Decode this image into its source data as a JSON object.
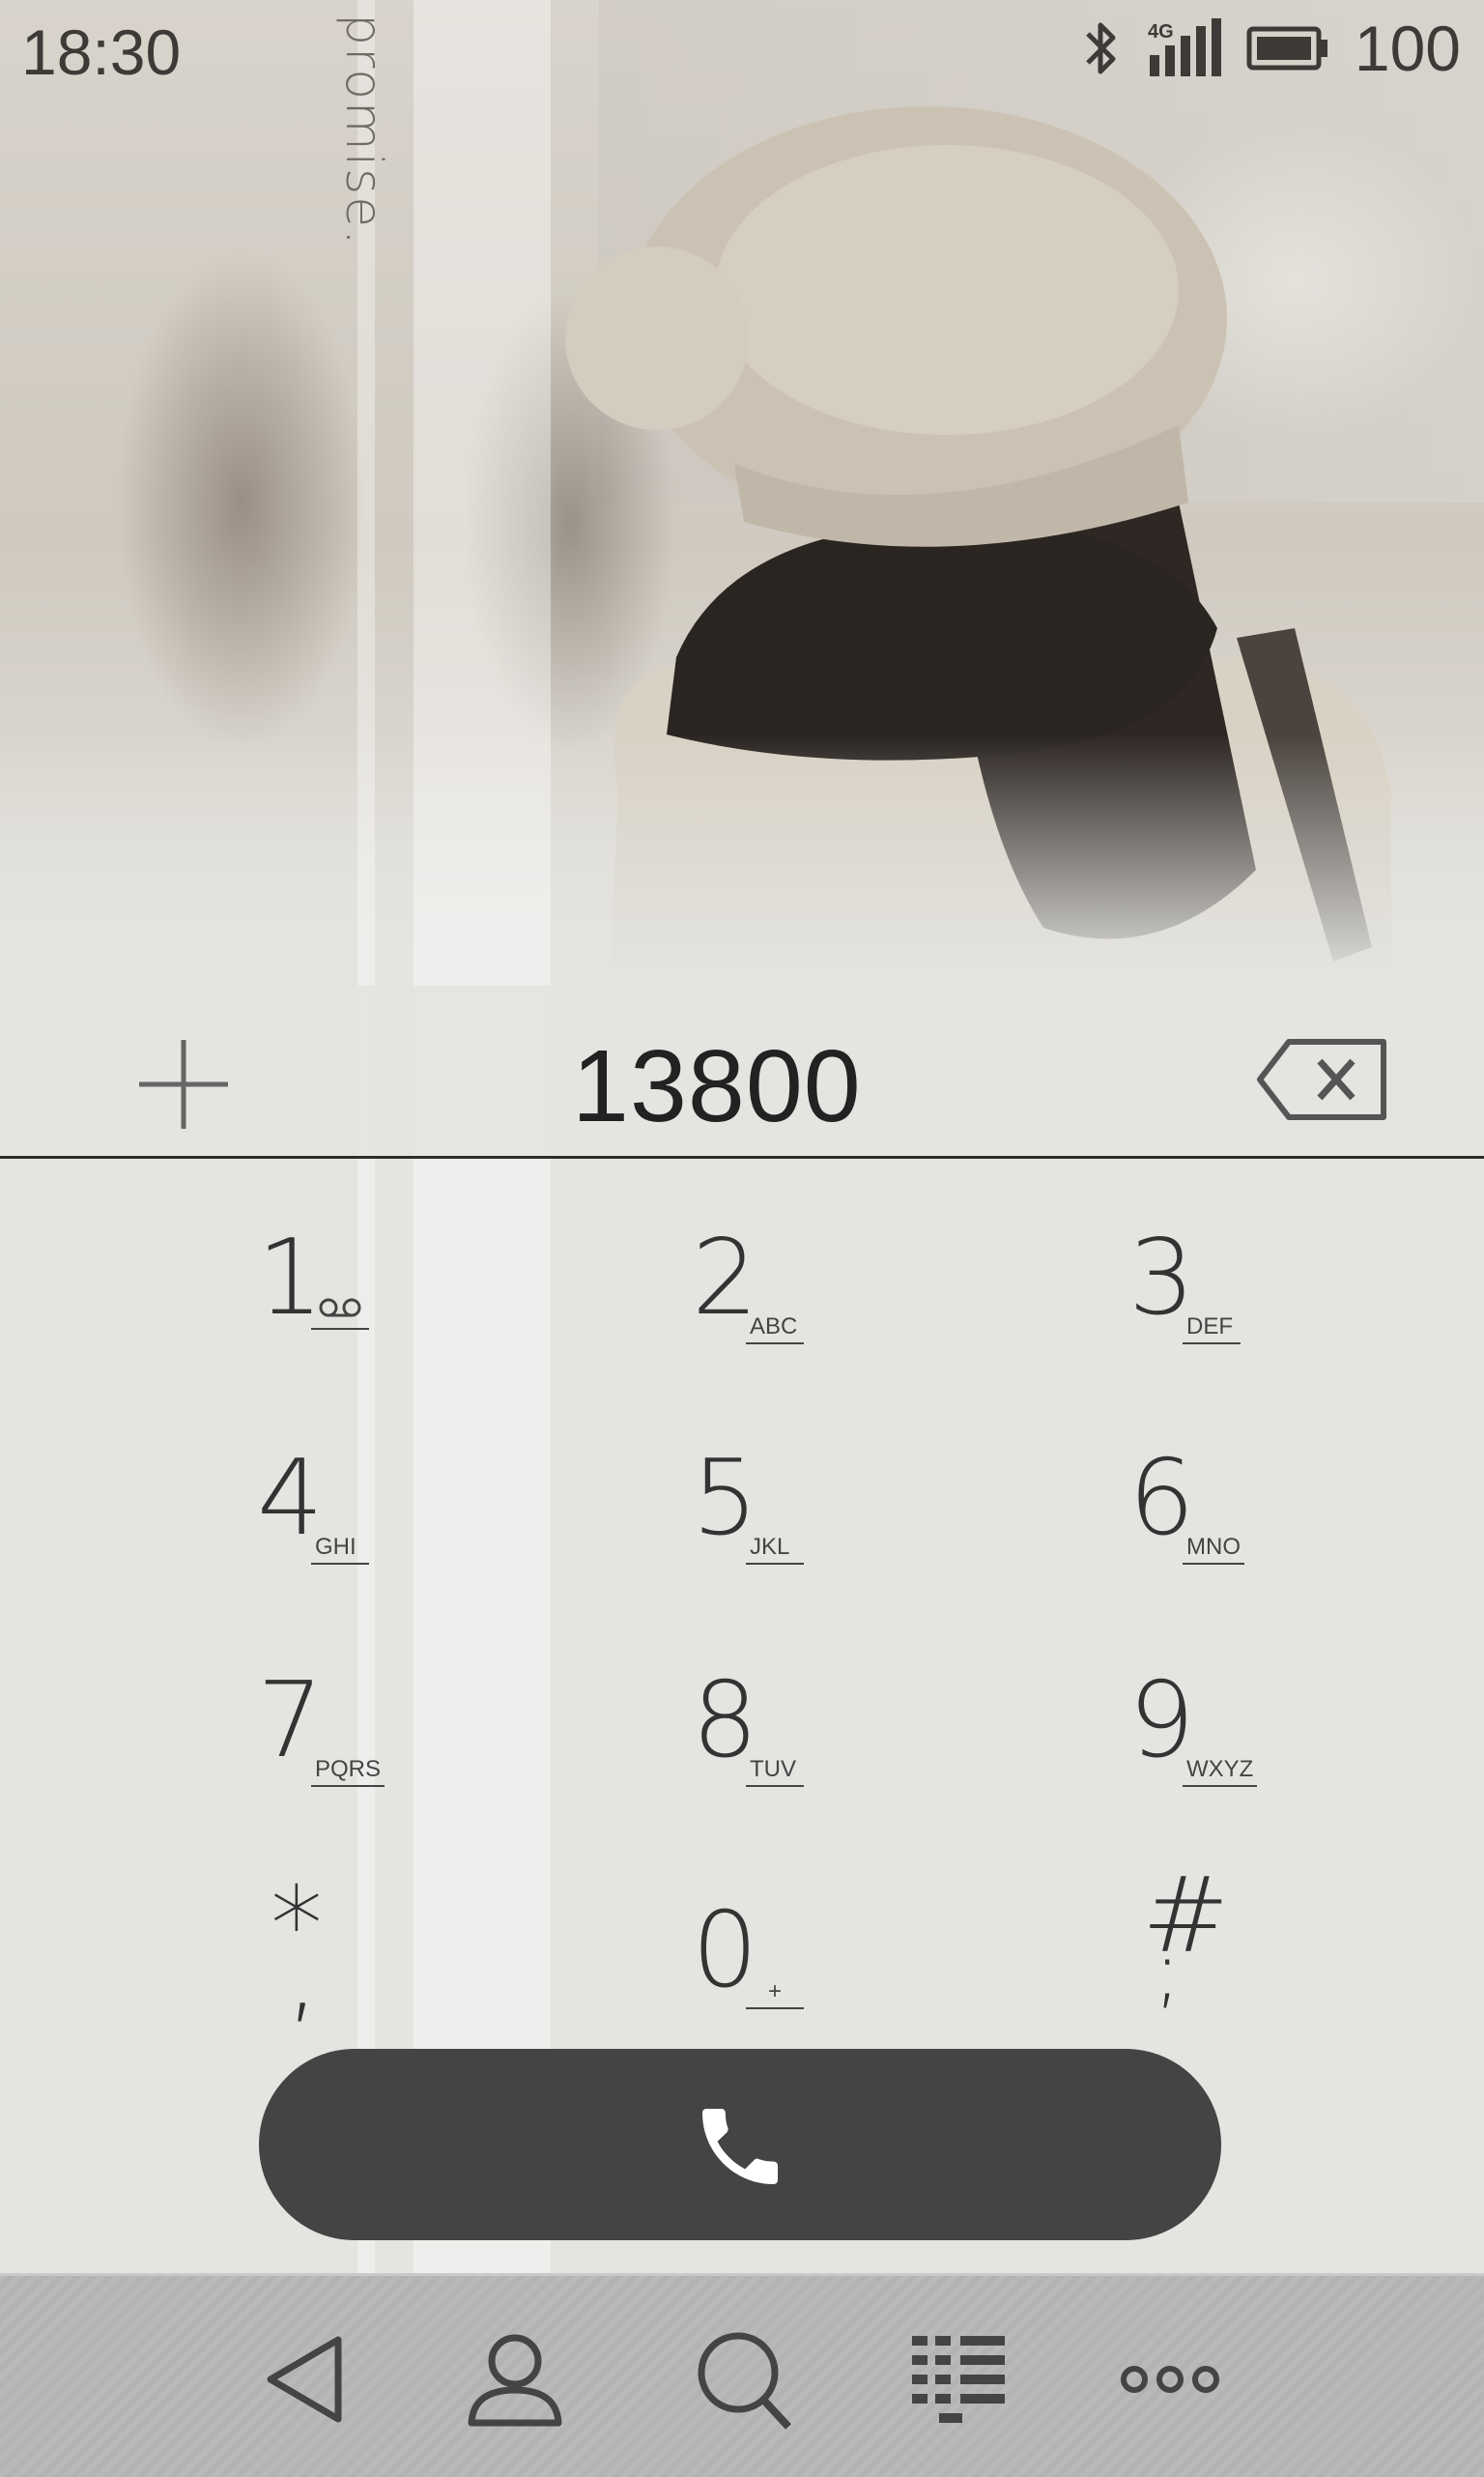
{
  "status_bar": {
    "time": "18:30",
    "network_type": "4G",
    "battery": "100",
    "icons": [
      "bluetooth-icon",
      "signal-4g-icon",
      "battery-icon"
    ]
  },
  "wallpaper": {
    "caption": "promise."
  },
  "dialer": {
    "number": "13800",
    "icons": {
      "add": "plus-icon",
      "delete": "backspace-icon",
      "call": "phone-icon"
    },
    "keys": [
      {
        "digit": "1",
        "letters": "",
        "icon": "voicemail-icon"
      },
      {
        "digit": "2",
        "letters": "ABC"
      },
      {
        "digit": "3",
        "letters": "DEF"
      },
      {
        "digit": "4",
        "letters": "GHI"
      },
      {
        "digit": "5",
        "letters": "JKL"
      },
      {
        "digit": "6",
        "letters": "MNO"
      },
      {
        "digit": "7",
        "letters": "PQRS"
      },
      {
        "digit": "8",
        "letters": "TUV"
      },
      {
        "digit": "9",
        "letters": "WXYZ"
      },
      {
        "digit": "*",
        "sub": ","
      },
      {
        "digit": "0",
        "letters": "+"
      },
      {
        "digit": "#",
        "sub": ";"
      }
    ]
  },
  "navbar": {
    "items": [
      "back-icon",
      "contacts-icon",
      "search-icon",
      "dialpad-icon",
      "more-icon"
    ]
  },
  "colors": {
    "call_button": "#444444",
    "background": "#e4e4e1",
    "navbar": "#b9b9b9"
  }
}
